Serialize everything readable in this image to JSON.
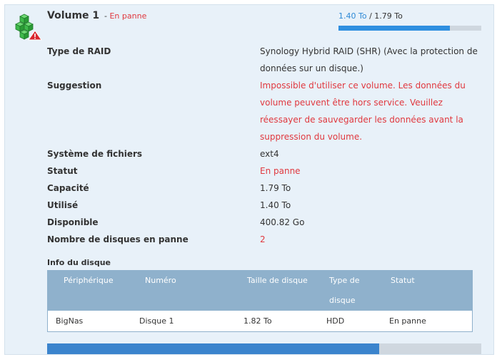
{
  "volume": {
    "title": "Volume 1",
    "status_dash": "-",
    "status": "En panne",
    "used": "1.40 To",
    "separator": "/",
    "total": "1.79 To",
    "usage_fraction": 0.78
  },
  "details": [
    {
      "label": "Type de RAID",
      "value": "Synology Hybrid RAID (SHR) (Avec la protection de données sur un disque.)",
      "red": false
    },
    {
      "label": "Suggestion",
      "value": "Impossible d'utiliser ce volume. Les données du volume peuvent être hors service. Veuillez réessayer de sauvegarder les données avant la suppression du volume.",
      "red": true
    },
    {
      "label": "Système de fichiers",
      "value": "ext4",
      "red": false
    },
    {
      "label": "Statut",
      "value": "En panne",
      "red": true
    },
    {
      "label": "Capacité",
      "value": "1.79 To",
      "red": false
    },
    {
      "label": "Utilisé",
      "value": "1.40 To",
      "red": false
    },
    {
      "label": "Disponible",
      "value": "400.82 Go",
      "red": false
    },
    {
      "label": "Nombre de disques en panne",
      "value": "2",
      "red": true
    }
  ],
  "disk_info": {
    "title": "Info du disque",
    "headers": [
      "Périphérique",
      "Numéro",
      "Taille de disque",
      "Type de disque",
      "Statut"
    ],
    "rows": [
      [
        "BigNas",
        "Disque 1",
        "1.82 To",
        "HDD",
        "En panne"
      ]
    ]
  },
  "bottom_progress_fraction": 0.765,
  "colors": {
    "error": "#e0383e",
    "accent": "#2f8fe0",
    "panel_bg": "#e8f1f9",
    "table_header": "#8fb1cc",
    "icon_green": "#3fb94b",
    "icon_warning": "#d9272e"
  },
  "icons": [
    "green-cubes-icon",
    "warning-triangle-icon"
  ]
}
